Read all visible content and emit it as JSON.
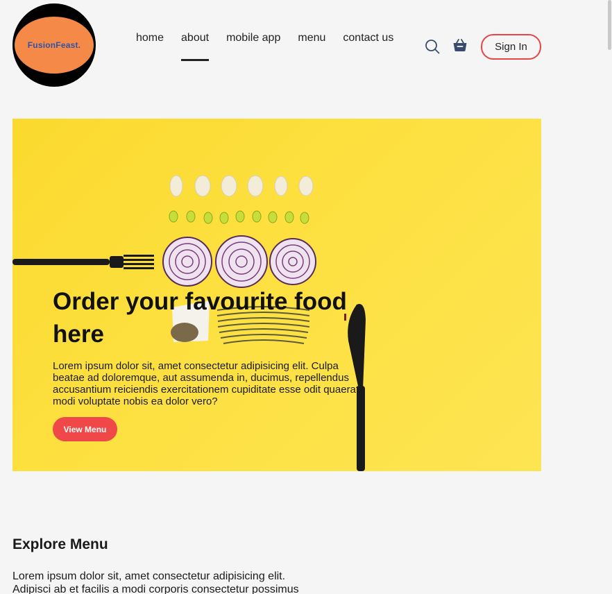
{
  "brand": {
    "name": "FusionFeast."
  },
  "nav": {
    "items": [
      {
        "label": "home"
      },
      {
        "label": "about",
        "active": true
      },
      {
        "label": "mobile app"
      },
      {
        "label": "menu"
      },
      {
        "label": "contact us"
      }
    ]
  },
  "header": {
    "search_icon": "search-icon",
    "cart_icon": "basket-icon",
    "signin_label": "Sign In"
  },
  "hero": {
    "title": "Order your favourite food here",
    "description": "Lorem ipsum dolor sit, amet consectetur adipisicing elit. Culpa beatae ad doloremque, aut assumenda in, ducimus, repellendus accusantium reiciendis exercitationem cupiditate esse odit quaerat modi voluptate nobis ea dolor vero?",
    "button_label": "View Menu",
    "background_color": "#fde040",
    "button_color": "#f04848"
  },
  "explore": {
    "title": "Explore Menu",
    "description": "Lorem ipsum dolor sit, amet consectetur adipisicing elit. Adipisci ab et facilis a modi corporis consectetur possimus"
  },
  "colors": {
    "accent": "#e84444",
    "logo_bg": "#f58a48",
    "logo_text": "#2b55a8",
    "icon": "#3a4a6e"
  }
}
